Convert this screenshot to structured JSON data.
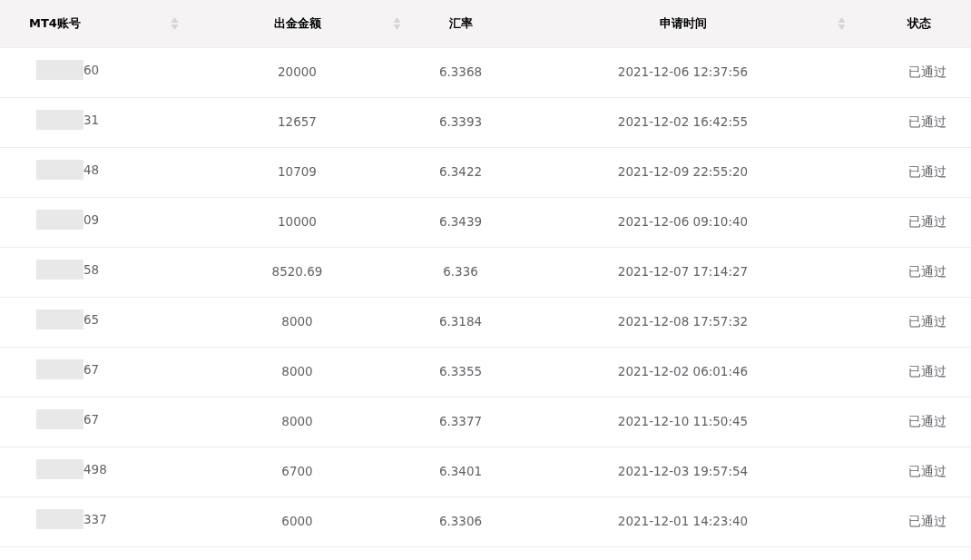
{
  "table": {
    "columns": [
      {
        "label": "MT4账号",
        "sortable": true
      },
      {
        "label": "出金金额",
        "sortable": true
      },
      {
        "label": "汇率",
        "sortable": false
      },
      {
        "label": "申请时间",
        "sortable": true
      },
      {
        "label": "状态",
        "sortable": false
      }
    ],
    "rows": [
      {
        "account": "60",
        "amount": "20000",
        "rate": "6.3368",
        "time": "2021-12-06 12:37:56",
        "status": "已通过"
      },
      {
        "account": "31",
        "amount": "12657",
        "rate": "6.3393",
        "time": "2021-12-02 16:42:55",
        "status": "已通过"
      },
      {
        "account": "48",
        "amount": "10709",
        "rate": "6.3422",
        "time": "2021-12-09 22:55:20",
        "status": "已通过"
      },
      {
        "account": "09",
        "amount": "10000",
        "rate": "6.3439",
        "time": "2021-12-06 09:10:40",
        "status": "已通过"
      },
      {
        "account": "58",
        "amount": "8520.69",
        "rate": "6.336",
        "time": "2021-12-07 17:14:27",
        "status": "已通过"
      },
      {
        "account": "65",
        "amount": "8000",
        "rate": "6.3184",
        "time": "2021-12-08 17:57:32",
        "status": "已通过"
      },
      {
        "account": "67",
        "amount": "8000",
        "rate": "6.3355",
        "time": "2021-12-02 06:01:46",
        "status": "已通过"
      },
      {
        "account": "67",
        "amount": "8000",
        "rate": "6.3377",
        "time": "2021-12-10 11:50:45",
        "status": "已通过"
      },
      {
        "account": "498",
        "amount": "6700",
        "rate": "6.3401",
        "time": "2021-12-03 19:57:54",
        "status": "已通过"
      },
      {
        "account": "337",
        "amount": "6000",
        "rate": "6.3306",
        "time": "2021-12-01 14:23:40",
        "status": "已通过"
      }
    ]
  }
}
